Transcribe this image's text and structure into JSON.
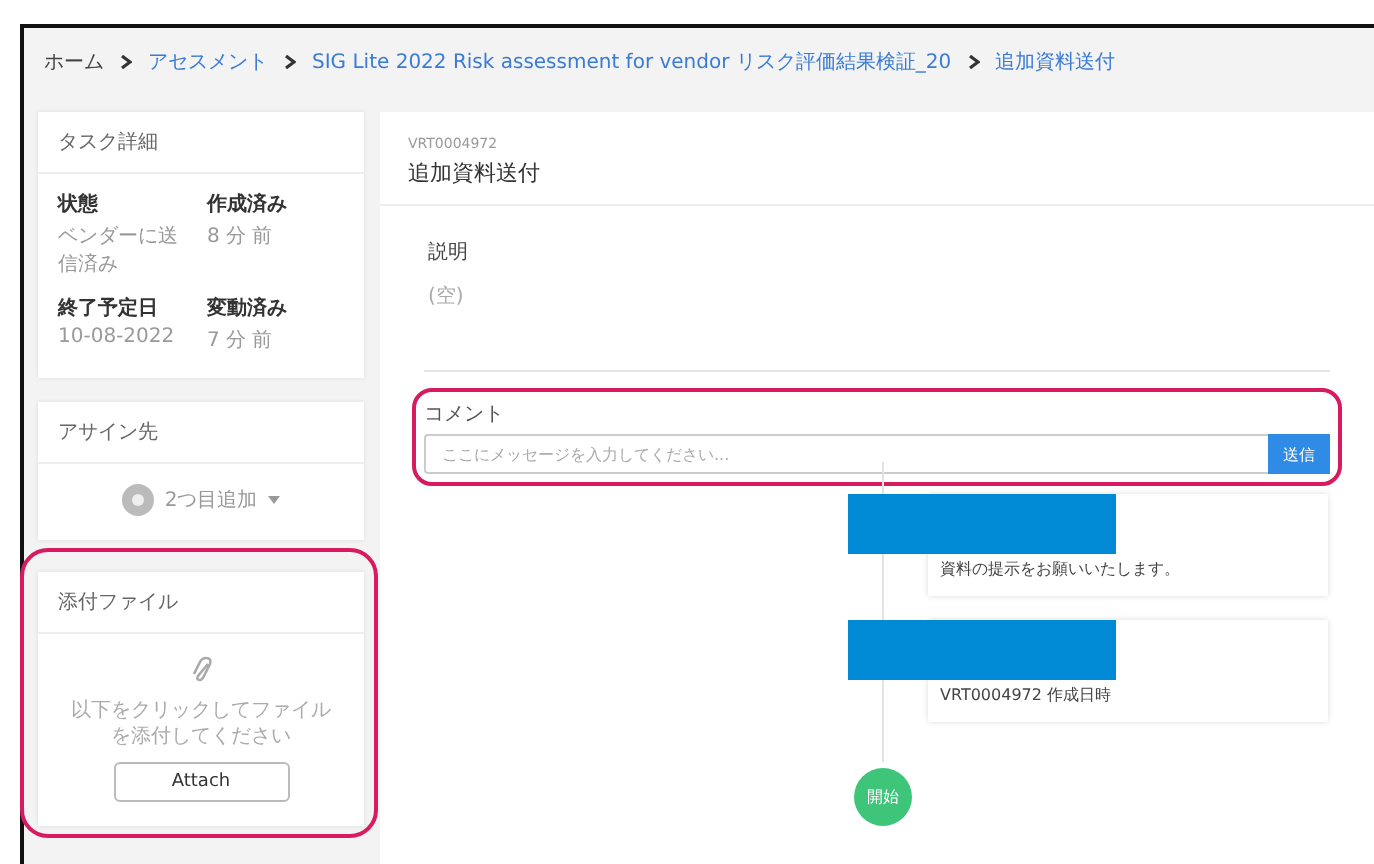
{
  "breadcrumb": [
    {
      "label": "ホーム",
      "link": false
    },
    {
      "label": "アセスメント",
      "link": true
    },
    {
      "label": "SIG Lite 2022 Risk assessment for vendor リスク評価結果検証_20",
      "link": true
    },
    {
      "label": "追加資料送付",
      "link": true
    }
  ],
  "task_details": {
    "title": "タスク詳細",
    "fields": [
      {
        "label": "状態",
        "value": "ベンダーに送信済み"
      },
      {
        "label": "作成済み",
        "value": "8 分 前"
      },
      {
        "label": "終了予定日",
        "value": "10-08-2022"
      },
      {
        "label": "変動済み",
        "value": "7 分 前"
      }
    ]
  },
  "assignee": {
    "title": "アサイン先",
    "add_label": "2つ目追加"
  },
  "attachments": {
    "title": "添付ファイル",
    "hint": "以下をクリックしてファイルを添付してください",
    "button": "Attach",
    "highlighted": true
  },
  "task": {
    "id": "VRT0004972",
    "title": "追加資料送付",
    "description_label": "説明",
    "description": "(空)"
  },
  "comment": {
    "label": "コメント",
    "placeholder": "ここにメッセージを入力してください...",
    "send": "送信",
    "highlighted": true
  },
  "timeline": {
    "entries": [
      {
        "text": "資料の提示をお願いいたします。",
        "redacted": true
      },
      {
        "text": "VRT0004972 作成日時",
        "redacted": true
      }
    ],
    "start": "開始"
  }
}
